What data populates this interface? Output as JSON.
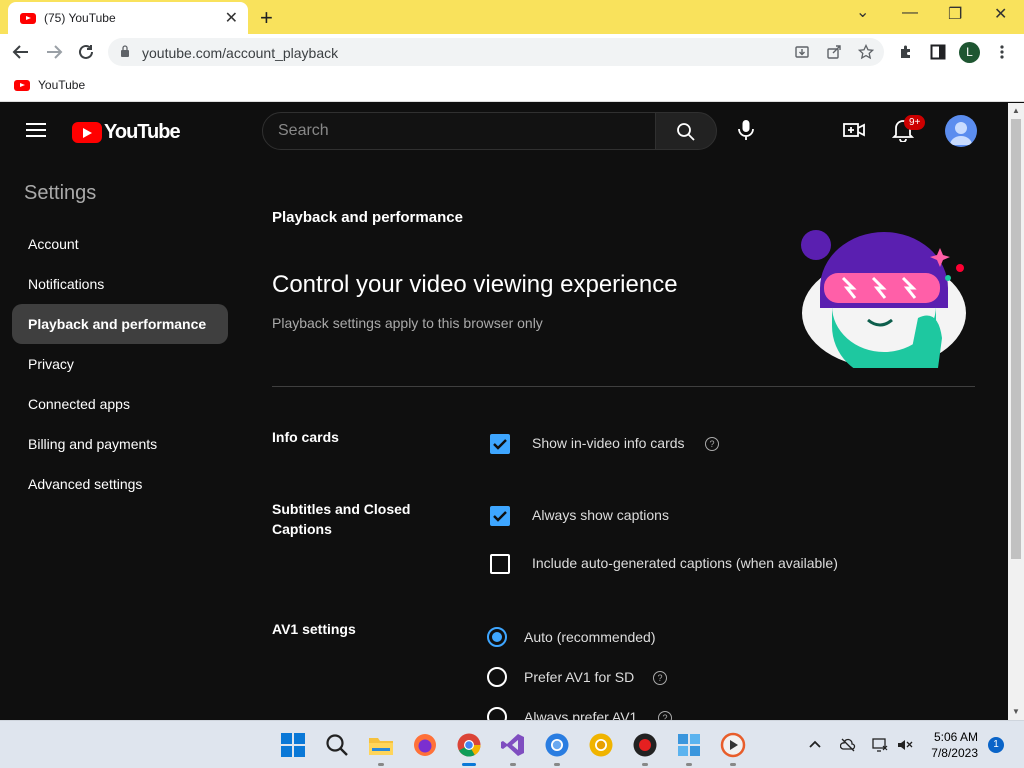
{
  "browser": {
    "tab_title": "(75) YouTube",
    "tab_close": "✕",
    "new_tab": "+",
    "url": "youtube.com/account_playback",
    "profile_initial": "L",
    "bookmark_label": "YouTube",
    "window_controls": {
      "chevron": "⌄",
      "minimize": "—",
      "restore": "❐",
      "close": "✕"
    }
  },
  "youtube": {
    "logo_text": "YouTube",
    "search_placeholder": "Search",
    "notification_badge": "9+",
    "settings_title": "Settings",
    "nav": [
      {
        "label": "Account"
      },
      {
        "label": "Notifications"
      },
      {
        "label": "Playback and performance",
        "active": true
      },
      {
        "label": "Privacy"
      },
      {
        "label": "Connected apps"
      },
      {
        "label": "Billing and payments"
      },
      {
        "label": "Advanced settings"
      }
    ],
    "section_heading": "Playback and performance",
    "hero_title": "Control your video viewing experience",
    "hero_subtitle": "Playback settings apply to this browser only",
    "info_cards": {
      "label": "Info cards",
      "option": "Show in-video info cards",
      "checked": true
    },
    "subtitles": {
      "label": "Subtitles and Closed Captions",
      "options": [
        {
          "text": "Always show captions",
          "checked": true
        },
        {
          "text": "Include auto-generated captions (when available)",
          "checked": false
        }
      ]
    },
    "av1": {
      "label": "AV1 settings",
      "options": [
        {
          "text": "Auto (recommended)",
          "selected": true
        },
        {
          "text": "Prefer AV1 for SD",
          "selected": false
        },
        {
          "text": "Always prefer AV1",
          "selected": false
        }
      ]
    },
    "help_glyph": "?"
  },
  "taskbar": {
    "time": "5:06 AM",
    "date": "7/8/2023",
    "notification_count": "1"
  },
  "colors": {
    "accent_blue": "#3ea6ff",
    "yt_red": "#ff0000",
    "tab_strip": "#f9e25c",
    "background": "#0f0f0f"
  }
}
